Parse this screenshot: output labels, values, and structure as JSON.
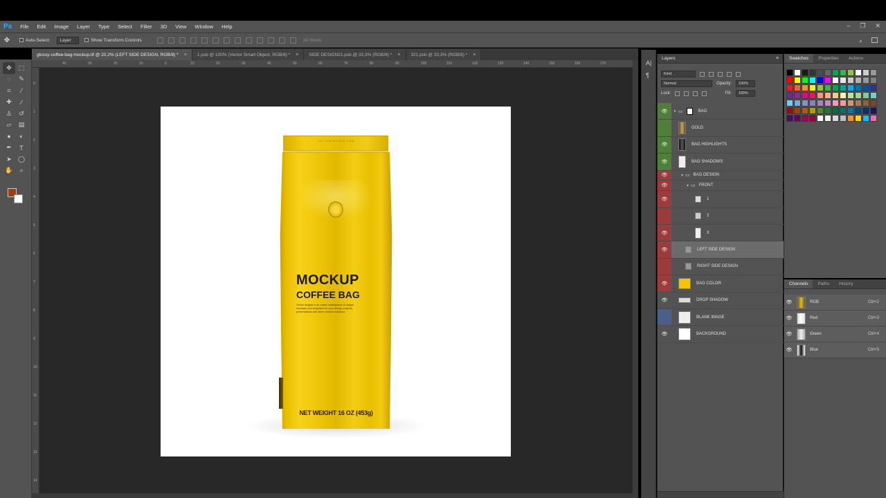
{
  "app": {
    "logo": "Ps"
  },
  "menu": [
    "File",
    "Edit",
    "Image",
    "Layer",
    "Type",
    "Select",
    "Filter",
    "3D",
    "View",
    "Window",
    "Help"
  ],
  "window_controls": [
    "–",
    "❐",
    "✕"
  ],
  "options": {
    "auto_select_label": "Auto-Select:",
    "auto_select_value": "Layer",
    "show_transform_label": "Show Transform Controls",
    "mode_3d_label": "3D Mode:"
  },
  "tabs": [
    {
      "label": "glossy-coffee-bag-mockup.tif @ 20,2% (LEFT SIDE DESIGN, RGB/8) *",
      "close": "×"
    },
    {
      "label": "1.psb @ 100% (Vector Smart Object, RGB/8) *",
      "close": "×"
    },
    {
      "label": "SIDE DESIGN21.psb @ 33,3% (RGB/8) *",
      "close": "×"
    },
    {
      "label": "321.psb @ 33,3% (RGB/8) *",
      "close": "×"
    }
  ],
  "ruler_top": [
    "40",
    "30",
    "20",
    "10",
    "0",
    "10",
    "20",
    "30",
    "40",
    "50",
    "60",
    "70",
    "80",
    "90",
    "100",
    "110",
    "120",
    "130",
    "140",
    "150",
    "160",
    "170"
  ],
  "ruler_left": [
    "0",
    "1",
    "2",
    "3",
    "4",
    "5",
    "6",
    "7",
    "8",
    "9",
    "10",
    "11",
    "12",
    "13",
    "14"
  ],
  "colors": {
    "foreground": "#9a3f0e",
    "background": "#ffffff",
    "bag_yellow": "#f0c70a",
    "canvas_bg": "#282828",
    "ui_panel": "#535353"
  },
  "bag": {
    "brand": "YELLOWIMAGES.COM",
    "title_line1": "MOCKUP",
    "title_line2": "COFFEE BAG",
    "description": "Yellow Images is an online marketplace of unique mockups and templates for your design projects, presentations and other creative solutions.",
    "net_weight": "NET WEIGHT 16 OZ (453g)"
  },
  "layers_panel": {
    "title": "Layers",
    "kind_label": "Kind",
    "blend_mode": "Normal",
    "opacity_label": "Opacity:",
    "opacity_value": "100%",
    "lock_label": "Lock:",
    "fill_label": "Fill:",
    "fill_value": "100%",
    "layers": [
      {
        "name": "BAG",
        "eye": "green",
        "type": "group"
      },
      {
        "name": "GOLD",
        "eye": "green",
        "type": "layer"
      },
      {
        "name": "BAG HIGHLIGHTS",
        "eye": "green",
        "type": "layer"
      },
      {
        "name": "BAG SHADOWS",
        "eye": "green",
        "type": "layer"
      },
      {
        "name": "BAG DESIGN",
        "eye": "red",
        "type": "group"
      },
      {
        "name": "FRONT",
        "eye": "red",
        "type": "group"
      },
      {
        "name": "1",
        "eye": "red",
        "type": "smart"
      },
      {
        "name": "2",
        "eye": "red",
        "type": "smart"
      },
      {
        "name": "3",
        "eye": "red",
        "type": "smart"
      },
      {
        "name": "LEFT SIDE DESIGN",
        "eye": "red",
        "type": "smart",
        "selected": true
      },
      {
        "name": "RIGHT SIDE DESIGN",
        "eye": "red",
        "type": "smart"
      },
      {
        "name": "BAG COLOR",
        "eye": "red",
        "type": "color"
      },
      {
        "name": "DROP SHADOW",
        "eye": "none",
        "type": "layer"
      },
      {
        "name": "BLANK IMAGE",
        "eye": "blue",
        "type": "layer"
      },
      {
        "name": "BACKGROUND",
        "eye": "none",
        "type": "layer"
      }
    ]
  },
  "swatch_tabs": [
    "Swatches",
    "Properties",
    "Actions"
  ],
  "swatch_colors": [
    "#000000",
    "#ffffff",
    "#1a1a1a",
    "#333333",
    "#4d4d4d",
    "#666666",
    "#00a651",
    "#39b54a",
    "#8dc63f",
    "#ffffff",
    "#cccccc",
    "#999999",
    "#ff0000",
    "#ffff00",
    "#00ff00",
    "#00ffff",
    "#0000ff",
    "#ff00ff",
    "#ffffff",
    "#e6e6e6",
    "#cccccc",
    "#b3b3b3",
    "#999999",
    "#808080",
    "#ed1c24",
    "#f26522",
    "#f7941d",
    "#fff200",
    "#8dc63f",
    "#39b54a",
    "#00a651",
    "#00a99d",
    "#00aeef",
    "#0072bc",
    "#0054a6",
    "#2e3192",
    "#662d91",
    "#92278f",
    "#ec008c",
    "#ed145b",
    "#f69679",
    "#f9ad81",
    "#fdc68a",
    "#fff79a",
    "#c4df9b",
    "#a3d39c",
    "#82ca9d",
    "#7accc8",
    "#6dcff6",
    "#7da7d9",
    "#8393ca",
    "#8781bd",
    "#a186be",
    "#bd8cbf",
    "#f49ac1",
    "#f6989d",
    "#c69c6d",
    "#a67c52",
    "#8c6239",
    "#754c24",
    "#9e0b0f",
    "#a0410d",
    "#a3620a",
    "#aba000",
    "#598527",
    "#1a7b30",
    "#007236",
    "#00746b",
    "#0076a3",
    "#004a80",
    "#003471",
    "#1b1464",
    "#440e62",
    "#630460",
    "#9e005d",
    "#9e0039",
    "#ffffff",
    "#f2f2f2",
    "#d9d9d9",
    "#bfbfbf",
    "#f7941d",
    "#ffd700",
    "#00bfff",
    "#ff69b4"
  ],
  "channels_panel": {
    "tabs": [
      "Channels",
      "Paths",
      "History"
    ],
    "channels": [
      {
        "name": "RGB",
        "shortcut": "Ctrl+2"
      },
      {
        "name": "Red",
        "shortcut": "Ctrl+3"
      },
      {
        "name": "Green",
        "shortcut": "Ctrl+4"
      },
      {
        "name": "Blue",
        "shortcut": "Ctrl+5"
      }
    ]
  }
}
